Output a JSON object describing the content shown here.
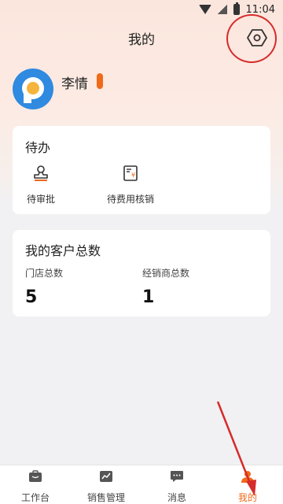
{
  "status_bar": {
    "time": "11:04",
    "icons": [
      "wifi-icon",
      "no-signal-icon",
      "battery-charging-icon"
    ]
  },
  "header": {
    "title": "我的",
    "settings_icon": "settings-hexagon-icon"
  },
  "profile": {
    "name": "李情",
    "avatar_icon": "avatar-icon"
  },
  "todo": {
    "title": "待办",
    "items": [
      {
        "label": "待审批",
        "icon": "stamp-icon"
      },
      {
        "label": "待费用核销",
        "icon": "expense-document-icon"
      }
    ]
  },
  "customers": {
    "title": "我的客户总数",
    "stats": [
      {
        "label": "门店总数",
        "value": "5"
      },
      {
        "label": "经销商总数",
        "value": "1"
      }
    ]
  },
  "tabbar": {
    "tabs": [
      {
        "label": "工作台",
        "icon": "briefcase-icon",
        "active": false
      },
      {
        "label": "销售管理",
        "icon": "chart-icon",
        "active": false
      },
      {
        "label": "消息",
        "icon": "message-icon",
        "active": false
      },
      {
        "label": "我的",
        "icon": "profile-icon",
        "active": true
      }
    ]
  },
  "colors": {
    "accent": "#f06a1a",
    "annotation": "#d62b2b",
    "avatar_bg": "#2f8ae0"
  }
}
